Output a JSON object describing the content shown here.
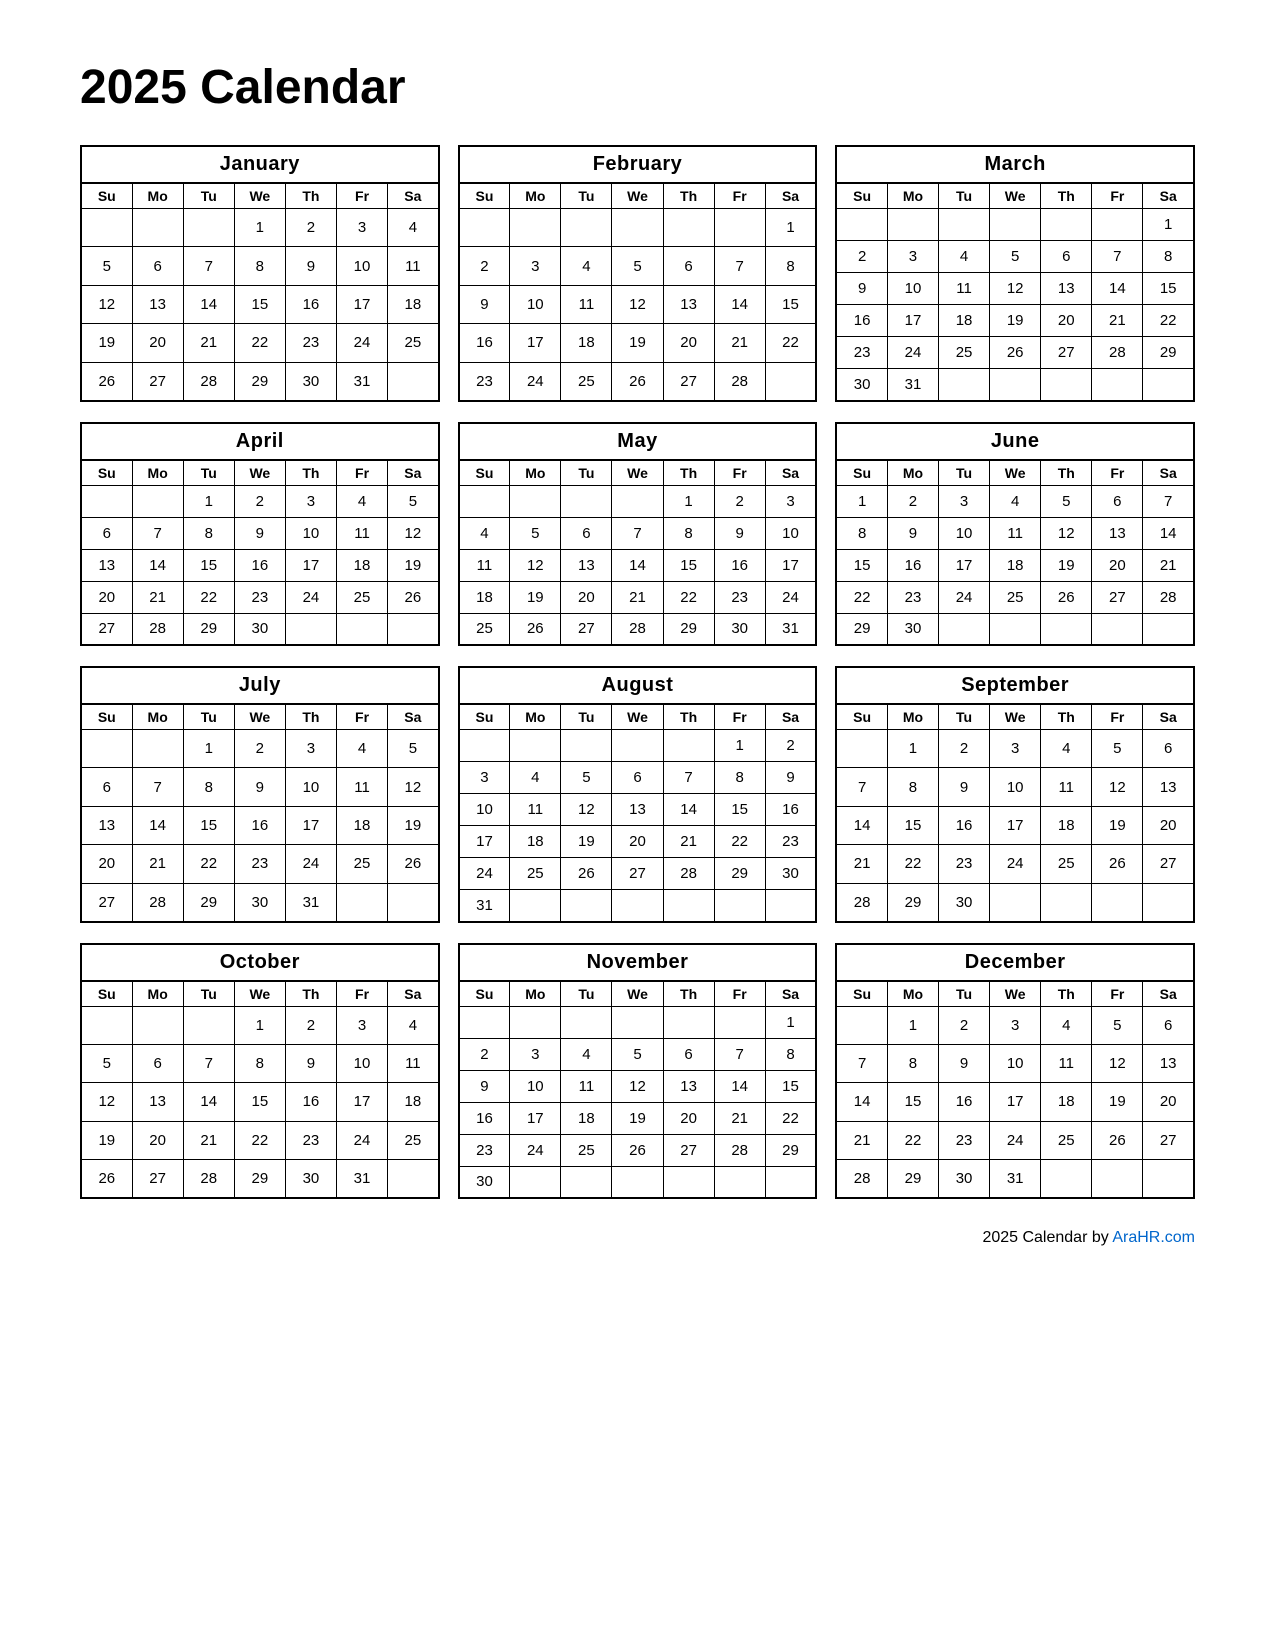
{
  "title": "2025 Calendar",
  "footer": {
    "text": "2025  Calendar by ",
    "link_label": "AraHR.com",
    "link_url": "https://AraHR.com"
  },
  "months": [
    {
      "name": "January",
      "days_header": [
        "Su",
        "Mo",
        "Tu",
        "We",
        "Th",
        "Fr",
        "Sa"
      ],
      "weeks": [
        [
          "",
          "",
          "",
          "1",
          "2",
          "3",
          "4"
        ],
        [
          "5",
          "6",
          "7",
          "8",
          "9",
          "10",
          "11"
        ],
        [
          "12",
          "13",
          "14",
          "15",
          "16",
          "17",
          "18"
        ],
        [
          "19",
          "20",
          "21",
          "22",
          "23",
          "24",
          "25"
        ],
        [
          "26",
          "27",
          "28",
          "29",
          "30",
          "31",
          ""
        ]
      ]
    },
    {
      "name": "February",
      "days_header": [
        "Su",
        "Mo",
        "Tu",
        "We",
        "Th",
        "Fr",
        "Sa"
      ],
      "weeks": [
        [
          "",
          "",
          "",
          "",
          "",
          "",
          "1"
        ],
        [
          "2",
          "3",
          "4",
          "5",
          "6",
          "7",
          "8"
        ],
        [
          "9",
          "10",
          "11",
          "12",
          "13",
          "14",
          "15"
        ],
        [
          "16",
          "17",
          "18",
          "19",
          "20",
          "21",
          "22"
        ],
        [
          "23",
          "24",
          "25",
          "26",
          "27",
          "28",
          ""
        ]
      ]
    },
    {
      "name": "March",
      "days_header": [
        "Su",
        "Mo",
        "Tu",
        "We",
        "Th",
        "Fr",
        "Sa"
      ],
      "weeks": [
        [
          "",
          "",
          "",
          "",
          "",
          "",
          "1"
        ],
        [
          "2",
          "3",
          "4",
          "5",
          "6",
          "7",
          "8"
        ],
        [
          "9",
          "10",
          "11",
          "12",
          "13",
          "14",
          "15"
        ],
        [
          "16",
          "17",
          "18",
          "19",
          "20",
          "21",
          "22"
        ],
        [
          "23",
          "24",
          "25",
          "26",
          "27",
          "28",
          "29"
        ],
        [
          "30",
          "31",
          "",
          "",
          "",
          "",
          ""
        ]
      ]
    },
    {
      "name": "April",
      "days_header": [
        "Su",
        "Mo",
        "Tu",
        "We",
        "Th",
        "Fr",
        "Sa"
      ],
      "weeks": [
        [
          "",
          "",
          "1",
          "2",
          "3",
          "4",
          "5"
        ],
        [
          "6",
          "7",
          "8",
          "9",
          "10",
          "11",
          "12"
        ],
        [
          "13",
          "14",
          "15",
          "16",
          "17",
          "18",
          "19"
        ],
        [
          "20",
          "21",
          "22",
          "23",
          "24",
          "25",
          "26"
        ],
        [
          "27",
          "28",
          "29",
          "30",
          "",
          "",
          ""
        ]
      ]
    },
    {
      "name": "May",
      "days_header": [
        "Su",
        "Mo",
        "Tu",
        "We",
        "Th",
        "Fr",
        "Sa"
      ],
      "weeks": [
        [
          "",
          "",
          "",
          "",
          "1",
          "2",
          "3"
        ],
        [
          "4",
          "5",
          "6",
          "7",
          "8",
          "9",
          "10"
        ],
        [
          "11",
          "12",
          "13",
          "14",
          "15",
          "16",
          "17"
        ],
        [
          "18",
          "19",
          "20",
          "21",
          "22",
          "23",
          "24"
        ],
        [
          "25",
          "26",
          "27",
          "28",
          "29",
          "30",
          "31"
        ]
      ]
    },
    {
      "name": "June",
      "days_header": [
        "Su",
        "Mo",
        "Tu",
        "We",
        "Th",
        "Fr",
        "Sa"
      ],
      "weeks": [
        [
          "1",
          "2",
          "3",
          "4",
          "5",
          "6",
          "7"
        ],
        [
          "8",
          "9",
          "10",
          "11",
          "12",
          "13",
          "14"
        ],
        [
          "15",
          "16",
          "17",
          "18",
          "19",
          "20",
          "21"
        ],
        [
          "22",
          "23",
          "24",
          "25",
          "26",
          "27",
          "28"
        ],
        [
          "29",
          "30",
          "",
          "",
          "",
          "",
          ""
        ]
      ]
    },
    {
      "name": "July",
      "days_header": [
        "Su",
        "Mo",
        "Tu",
        "We",
        "Th",
        "Fr",
        "Sa"
      ],
      "weeks": [
        [
          "",
          "",
          "1",
          "2",
          "3",
          "4",
          "5"
        ],
        [
          "6",
          "7",
          "8",
          "9",
          "10",
          "11",
          "12"
        ],
        [
          "13",
          "14",
          "15",
          "16",
          "17",
          "18",
          "19"
        ],
        [
          "20",
          "21",
          "22",
          "23",
          "24",
          "25",
          "26"
        ],
        [
          "27",
          "28",
          "29",
          "30",
          "31",
          "",
          ""
        ]
      ]
    },
    {
      "name": "August",
      "days_header": [
        "Su",
        "Mo",
        "Tu",
        "We",
        "Th",
        "Fr",
        "Sa"
      ],
      "weeks": [
        [
          "",
          "",
          "",
          "",
          "",
          "1",
          "2"
        ],
        [
          "3",
          "4",
          "5",
          "6",
          "7",
          "8",
          "9"
        ],
        [
          "10",
          "11",
          "12",
          "13",
          "14",
          "15",
          "16"
        ],
        [
          "17",
          "18",
          "19",
          "20",
          "21",
          "22",
          "23"
        ],
        [
          "24",
          "25",
          "26",
          "27",
          "28",
          "29",
          "30"
        ],
        [
          "31",
          "",
          "",
          "",
          "",
          "",
          ""
        ]
      ]
    },
    {
      "name": "September",
      "days_header": [
        "Su",
        "Mo",
        "Tu",
        "We",
        "Th",
        "Fr",
        "Sa"
      ],
      "weeks": [
        [
          "",
          "1",
          "2",
          "3",
          "4",
          "5",
          "6"
        ],
        [
          "7",
          "8",
          "9",
          "10",
          "11",
          "12",
          "13"
        ],
        [
          "14",
          "15",
          "16",
          "17",
          "18",
          "19",
          "20"
        ],
        [
          "21",
          "22",
          "23",
          "24",
          "25",
          "26",
          "27"
        ],
        [
          "28",
          "29",
          "30",
          "",
          "",
          "",
          ""
        ]
      ]
    },
    {
      "name": "October",
      "days_header": [
        "Su",
        "Mo",
        "Tu",
        "We",
        "Th",
        "Fr",
        "Sa"
      ],
      "weeks": [
        [
          "",
          "",
          "",
          "1",
          "2",
          "3",
          "4"
        ],
        [
          "5",
          "6",
          "7",
          "8",
          "9",
          "10",
          "11"
        ],
        [
          "12",
          "13",
          "14",
          "15",
          "16",
          "17",
          "18"
        ],
        [
          "19",
          "20",
          "21",
          "22",
          "23",
          "24",
          "25"
        ],
        [
          "26",
          "27",
          "28",
          "29",
          "30",
          "31",
          ""
        ]
      ]
    },
    {
      "name": "November",
      "days_header": [
        "Su",
        "Mo",
        "Tu",
        "We",
        "Th",
        "Fr",
        "Sa"
      ],
      "weeks": [
        [
          "",
          "",
          "",
          "",
          "",
          "",
          "1"
        ],
        [
          "2",
          "3",
          "4",
          "5",
          "6",
          "7",
          "8"
        ],
        [
          "9",
          "10",
          "11",
          "12",
          "13",
          "14",
          "15"
        ],
        [
          "16",
          "17",
          "18",
          "19",
          "20",
          "21",
          "22"
        ],
        [
          "23",
          "24",
          "25",
          "26",
          "27",
          "28",
          "29"
        ],
        [
          "30",
          "",
          "",
          "",
          "",
          "",
          ""
        ]
      ]
    },
    {
      "name": "December",
      "days_header": [
        "Su",
        "Mo",
        "Tu",
        "We",
        "Th",
        "Fr",
        "Sa"
      ],
      "weeks": [
        [
          "",
          "1",
          "2",
          "3",
          "4",
          "5",
          "6"
        ],
        [
          "7",
          "8",
          "9",
          "10",
          "11",
          "12",
          "13"
        ],
        [
          "14",
          "15",
          "16",
          "17",
          "18",
          "19",
          "20"
        ],
        [
          "21",
          "22",
          "23",
          "24",
          "25",
          "26",
          "27"
        ],
        [
          "28",
          "29",
          "30",
          "31",
          "",
          "",
          ""
        ]
      ]
    }
  ]
}
